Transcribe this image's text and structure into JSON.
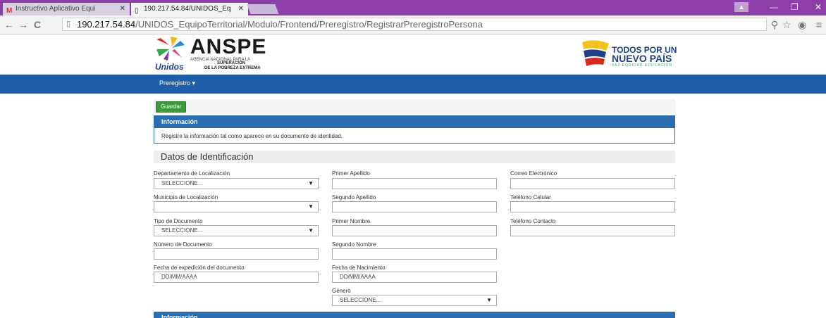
{
  "browser": {
    "tabs": [
      {
        "label": "Instructivo Aplicativo Equi",
        "favicon": "gmail-icon"
      },
      {
        "label": "190.217.54.84/UNIDOS_Eq",
        "favicon": "page-icon"
      }
    ],
    "url_host": "190.217.54.84",
    "url_path": "/UNIDOS_EquipoTerritorial/Modulo/Frontend/Preregistro/RegistrarPreregistroPersona"
  },
  "header": {
    "anspe_title": "ANSPE",
    "anspe_line1": "AGENCIA NACIONAL PARA LA",
    "anspe_line2": "SUPERACIÓN",
    "anspe_line3": "DE LA POBREZA EXTREMA",
    "unidos": "Unidos",
    "tpnp_line1": "TODOS POR UN",
    "tpnp_line2": "NUEVO PAÍS",
    "tpnp_line3": "PAZ EQUIDAD EDUCACIÓN"
  },
  "nav": {
    "preregistro": "Preregistro ▾"
  },
  "toolbar": {
    "save_label": "Guardar"
  },
  "info_panel": {
    "title": "Información",
    "message": "Registre la información tal como aparece en su documento de identidad."
  },
  "section_title": "Datos de Identificación",
  "form": {
    "col1": {
      "departamento": {
        "label": "Departamento de Localización",
        "value": "SELECCIONE..."
      },
      "municipio": {
        "label": "Municipio de Localización",
        "value": ""
      },
      "tipo_documento": {
        "label": "Tipo de Documento",
        "value": "SELECCIONE..."
      },
      "numero_documento": {
        "label": "Número de Documento",
        "value": ""
      },
      "fecha_expedicion": {
        "label": "Fecha de expedición del documento",
        "placeholder": "DD/MM/AAAA"
      }
    },
    "col2": {
      "primer_apellido": {
        "label": "Primer Apellido",
        "value": ""
      },
      "segundo_apellido": {
        "label": "Segundo Apellido",
        "value": ""
      },
      "primer_nombre": {
        "label": "Primer Nombre",
        "value": ""
      },
      "segundo_nombre": {
        "label": "Segundo Nombre",
        "value": ""
      },
      "fecha_nacimiento": {
        "label": "Fecha de Nacimiento",
        "placeholder": "DD/MM/AAAA"
      },
      "genero": {
        "label": "Género",
        "value": "SELECCIONE..."
      }
    },
    "col3": {
      "correo": {
        "label": "Correo Electrónico",
        "value": ""
      },
      "telefono_celular": {
        "label": "Teléfono Celular",
        "value": ""
      },
      "telefono_contacto": {
        "label": "Teléfono Contacto",
        "value": ""
      }
    }
  },
  "info_panel_2": {
    "title": "Información"
  },
  "colors": {
    "brand_blue": "#1f5ea8",
    "panel_blue": "#2a6db0",
    "save_green": "#3c9a3c",
    "chrome_purple": "#8c3fa8"
  }
}
